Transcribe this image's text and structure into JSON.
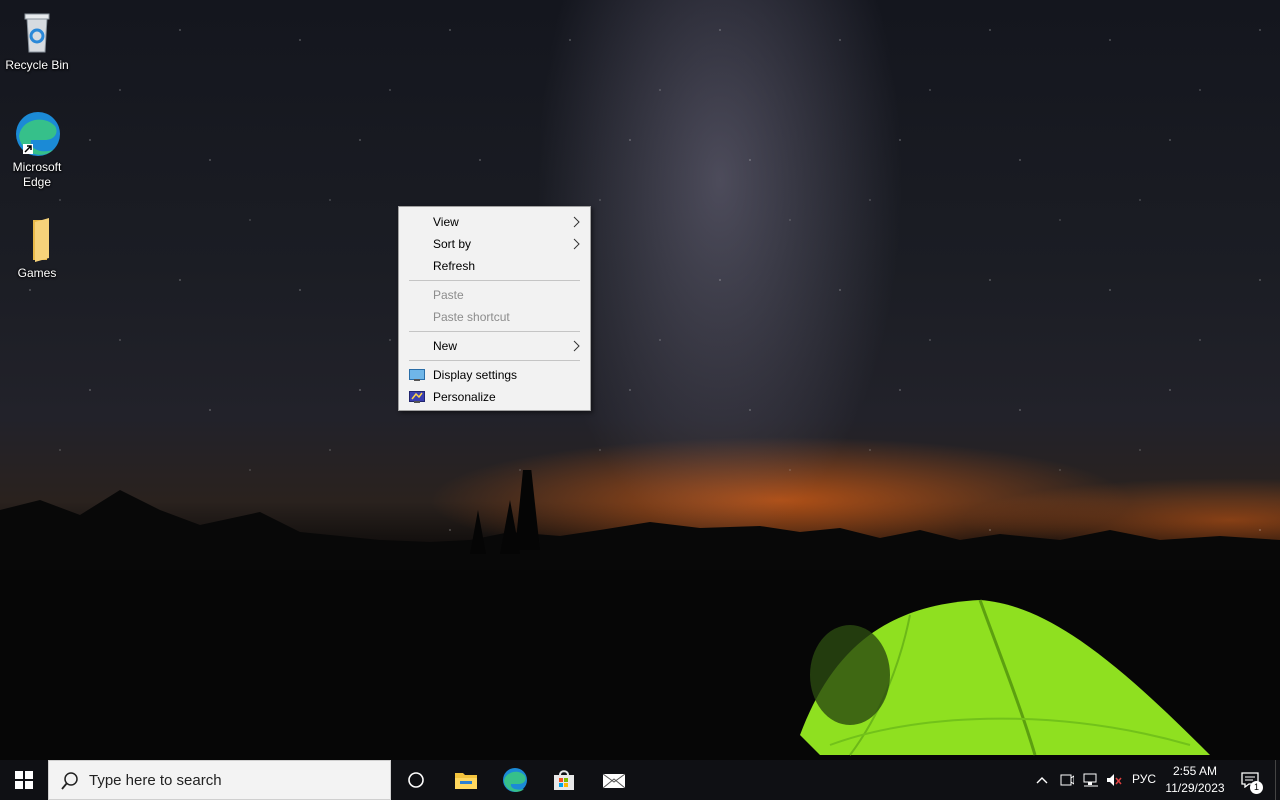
{
  "desktop": {
    "icons": [
      {
        "label": "Recycle Bin",
        "icon": "recycle-bin-icon"
      },
      {
        "label": "Microsoft Edge",
        "icon": "edge-icon"
      },
      {
        "label": "Games",
        "icon": "folder-icon"
      }
    ]
  },
  "context_menu": {
    "items": [
      {
        "label": "View",
        "has_submenu": true,
        "enabled": true
      },
      {
        "label": "Sort by",
        "has_submenu": true,
        "enabled": true
      },
      {
        "label": "Refresh",
        "enabled": true
      },
      {
        "label": "Paste",
        "enabled": false
      },
      {
        "label": "Paste shortcut",
        "enabled": false
      },
      {
        "label": "New",
        "has_submenu": true,
        "enabled": true
      },
      {
        "label": "Display settings",
        "icon": "display-settings-icon",
        "enabled": true
      },
      {
        "label": "Personalize",
        "icon": "personalize-icon",
        "enabled": true
      }
    ]
  },
  "taskbar": {
    "search_placeholder": "Type here to search",
    "pinned": [
      "task-view-icon",
      "file-explorer-icon",
      "edge-icon",
      "store-icon",
      "mail-icon"
    ],
    "tray": {
      "language": "РУС",
      "time": "2:55 AM",
      "date": "11/29/2023",
      "notification_count": "1"
    }
  },
  "colors": {
    "taskbar": "#0f1014",
    "menu_background": "#f2f2f2",
    "disabled_text": "#8c8c8c",
    "tent_green": "#8fe020"
  }
}
